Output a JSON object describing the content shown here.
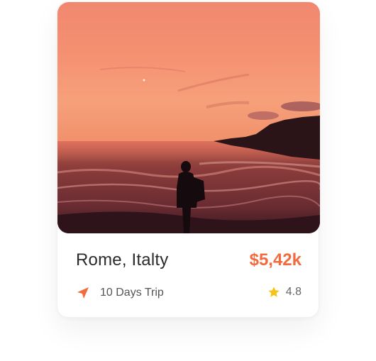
{
  "card": {
    "title": "Rome, Italty",
    "price": "$5,42k",
    "trip_length": "10 Days Trip",
    "rating": "4.8",
    "image_icon": "sunset-beach-photo",
    "trip_icon": "navigation-arrow-icon",
    "rating_icon": "star-icon"
  },
  "colors": {
    "accent": "#f26a3d",
    "star": "#f7c31a",
    "title_text": "#2b2b2b",
    "meta_text": "#555555"
  }
}
